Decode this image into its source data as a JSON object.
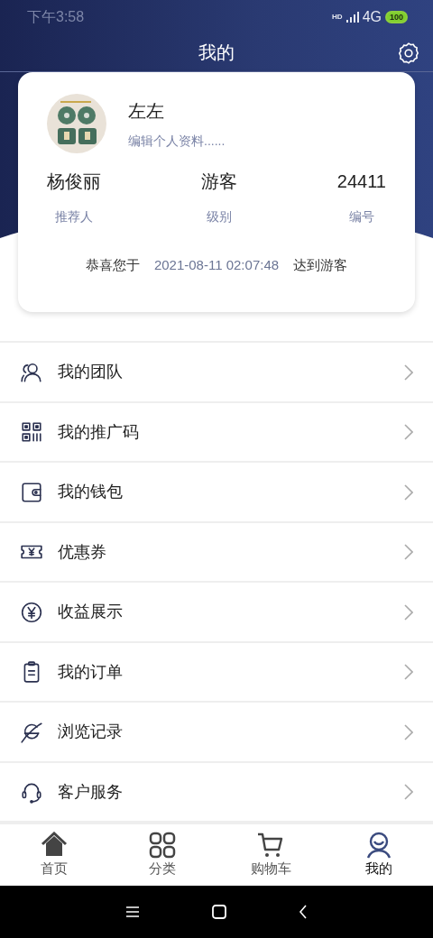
{
  "status_bar": {
    "time": "下午3:58",
    "hd": "HD",
    "network": "4G",
    "battery": "100"
  },
  "header": {
    "title": "我的"
  },
  "profile": {
    "nickname": "左左",
    "edit_link": "编辑个人资料......",
    "stats": [
      {
        "value": "杨俊丽",
        "label": "推荐人"
      },
      {
        "value": "游客",
        "label": "级别"
      },
      {
        "value": "24411",
        "label": "编号"
      }
    ],
    "congrats": {
      "prefix": "恭喜您于",
      "date": "2021-08-11 02:07:48",
      "suffix": "达到游客"
    }
  },
  "menu": [
    {
      "label": "我的团队"
    },
    {
      "label": "我的推广码"
    },
    {
      "label": "我的钱包"
    },
    {
      "label": "优惠券"
    },
    {
      "label": "收益展示"
    },
    {
      "label": "我的订单"
    },
    {
      "label": "浏览记录"
    },
    {
      "label": "客户服务"
    }
  ],
  "tab_bar": [
    {
      "label": "首页",
      "selected": false
    },
    {
      "label": "分类",
      "selected": false
    },
    {
      "label": "购物车",
      "selected": false
    },
    {
      "label": "我的",
      "selected": true
    }
  ]
}
